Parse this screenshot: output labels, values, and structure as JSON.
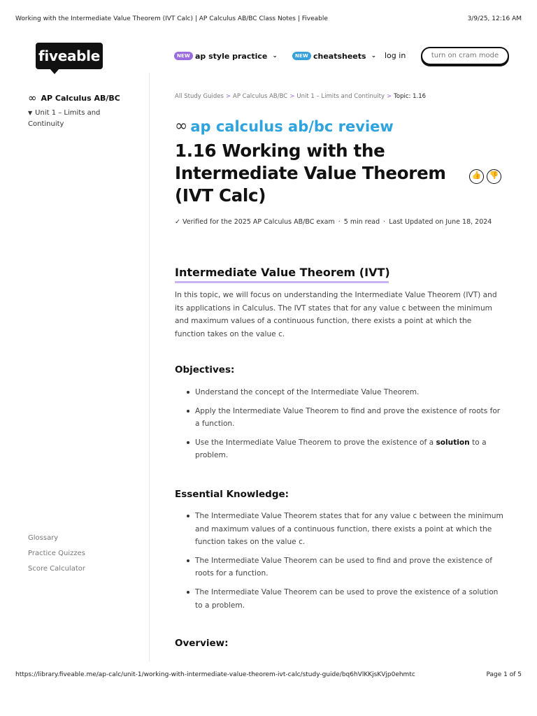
{
  "print": {
    "title": "Working with the Intermediate Value Theorem (IVT Calc) | AP Calculus AB/BC Class Notes | Fiveable",
    "date": "3/9/25, 12:16 AM",
    "url": "https://library.fiveable.me/ap-calc/unit-1/working-with-intermediate-value-theorem-ivt-calc/study-guide/bq6hVlKKjsKVjp0ehmtc",
    "page": "Page 1 of 5"
  },
  "nav": {
    "logo": "fiveable",
    "items": [
      {
        "badge": "NEW",
        "label": "ap style practice",
        "badge_color": "#9b6ce0"
      },
      {
        "badge": "NEW",
        "label": "cheatsheets",
        "badge_color": "#38a1dc"
      }
    ],
    "login": "log in",
    "cram": "turn on cram mode"
  },
  "sidebar": {
    "course_icon": "∞",
    "course": "AP Calculus AB/BC",
    "unit": "Unit 1 – Limits and Continuity",
    "links": [
      "Glossary",
      "Practice Quizzes",
      "Score Calculator"
    ]
  },
  "breadcrumb": {
    "items": [
      "All Study Guides",
      "AP Calculus AB/BC",
      "Unit 1 – Limits and Continuity"
    ],
    "current": "Topic: 1.16"
  },
  "header": {
    "review_icon": "∞",
    "review": "ap calculus ab/bc review",
    "title": "1.16 Working with the Intermediate Value Theorem (IVT Calc)",
    "meta_verified": "Verified for the 2025 AP Calculus AB/BC exam",
    "meta_read": "5 min read",
    "meta_updated": "Last Updated on June 18, 2024"
  },
  "content": {
    "section_title": "Intermediate Value Theorem (IVT)",
    "intro": "In this topic, we will focus on understanding the Intermediate Value Theorem (IVT) and its applications in Calculus. The IVT states that for any value c between the minimum and maximum values of a continuous function, there exists a point at which the function takes on the value c.",
    "objectives_title": "Objectives:",
    "objectives": [
      "Understand the concept of the Intermediate Value Theorem.",
      "Apply the Intermediate Value Theorem to find and prove the existence of roots for a function."
    ],
    "objective3_pre": "Use the Intermediate Value Theorem to prove the existence of a ",
    "objective3_bold": "solution",
    "objective3_post": " to a problem.",
    "knowledge_title": "Essential Knowledge:",
    "knowledge": [
      "The Intermediate Value Theorem states that for any value c between the minimum and maximum values of a continuous function, there exists a point at which the function takes on the value c.",
      "The Intermediate Value Theorem can be used to find and prove the existence of roots for a function.",
      "The Intermediate Value Theorem can be used to prove the existence of a solution to a problem."
    ],
    "overview_title": "Overview:"
  },
  "colors": {
    "accent_blue": "#2fa3dd",
    "accent_purple": "#9b6ce0",
    "underline": "#c9b3f1"
  },
  "icons": [
    "infinity-icon",
    "chevron-down-icon",
    "caret-down-icon",
    "checkmark-icon",
    "thumbs-up-icon",
    "thumbs-down-icon"
  ]
}
